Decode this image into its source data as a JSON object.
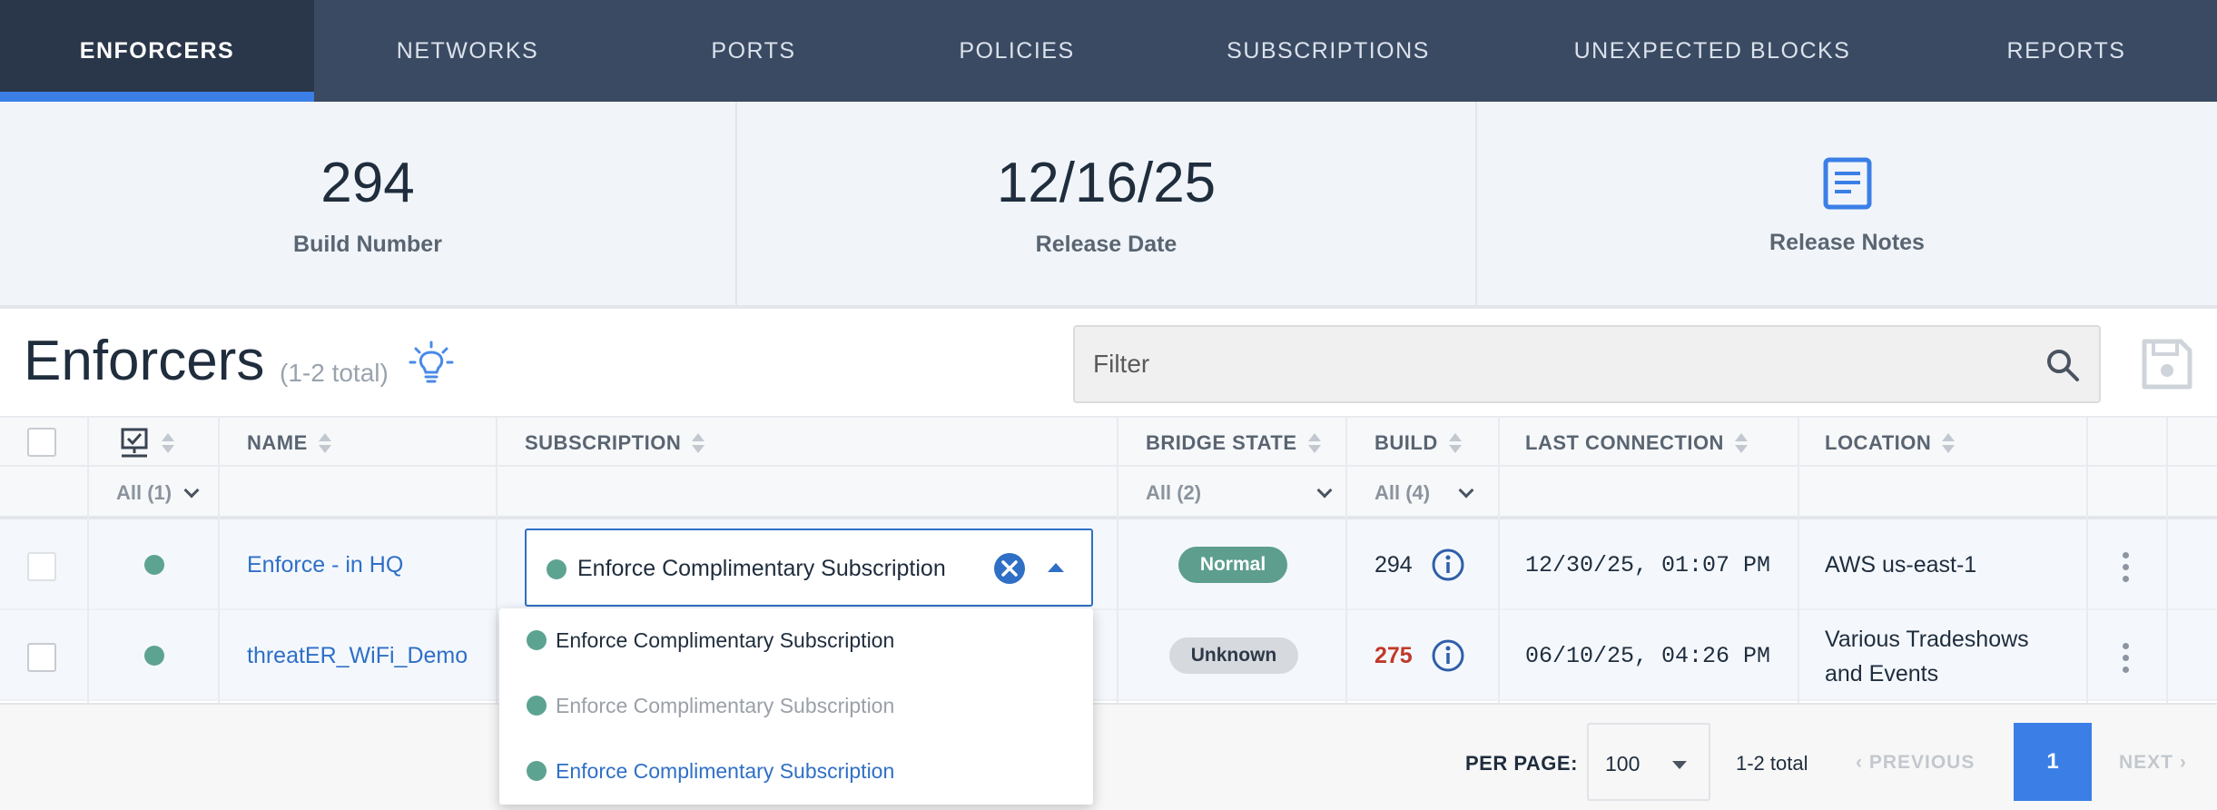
{
  "nav": {
    "tabs": [
      {
        "label": "ENFORCERS",
        "active": true
      },
      {
        "label": "NETWORKS"
      },
      {
        "label": "PORTS"
      },
      {
        "label": "POLICIES"
      },
      {
        "label": "SUBSCRIPTIONS"
      },
      {
        "label": "UNEXPECTED BLOCKS"
      },
      {
        "label": "REPORTS"
      }
    ]
  },
  "stats": {
    "build_number": {
      "value": "294",
      "label": "Build Number"
    },
    "release_date": {
      "value": "12/16/25",
      "label": "Release Date"
    },
    "release_notes": {
      "label": "Release Notes",
      "icon": "document-icon"
    }
  },
  "header": {
    "title": "Enforcers",
    "count": "(1-2 total)",
    "filter_placeholder": "Filter"
  },
  "table": {
    "columns": [
      "NAME",
      "SUBSCRIPTION",
      "BRIDGE STATE",
      "BUILD",
      "LAST CONNECTION",
      "LOCATION"
    ],
    "filters": {
      "status": "All (1)",
      "bridge_state": "All (2)",
      "build": "All (4)"
    },
    "rows": [
      {
        "name": "Enforce - in HQ",
        "subscription": "Enforce Complimentary Subscription",
        "bridge_state": "Normal",
        "build": "294",
        "last_connection": "12/30/25, 01:07 PM",
        "location": "AWS us-east-1"
      },
      {
        "name": "threatER_WiFi_Demo",
        "subscription": "",
        "bridge_state": "Unknown",
        "build": "275",
        "last_connection": "06/10/25, 04:26 PM",
        "location_line1": "Various Tradeshows",
        "location_line2": "and Events"
      }
    ]
  },
  "dropdown": {
    "options": [
      "Enforce Complimentary Subscription",
      "Enforce Complimentary Subscription",
      "Enforce Complimentary Subscription"
    ]
  },
  "pagination": {
    "per_page_label": "PER PAGE:",
    "per_page": "100",
    "total": "1-2 total",
    "previous": "PREVIOUS",
    "current_page": "1",
    "next": "NEXT"
  },
  "colors": {
    "nav_bg": "#3a4a62",
    "accent": "#3b7fe6",
    "link": "#2f6fc6",
    "status_green": "#5da391",
    "build_warning": "#c0392b"
  }
}
